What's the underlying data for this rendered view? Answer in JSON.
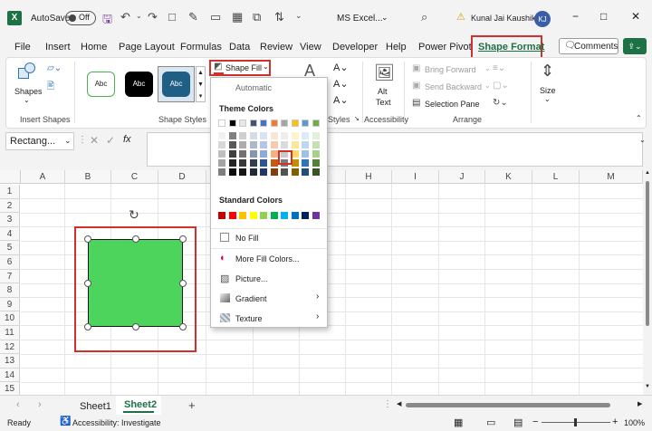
{
  "titlebar": {
    "autosave_label": "AutoSave",
    "autosave_state": "Off",
    "file_name": "MS Excel...",
    "user_name": "Kunal Jai Kaushik",
    "user_initials": "KJ"
  },
  "menu": {
    "tabs": [
      "File",
      "Insert",
      "Home",
      "Page Layout",
      "Formulas",
      "Data",
      "Review",
      "View",
      "Developer",
      "Help",
      "Power Pivot",
      "Shape Format"
    ],
    "active_tab": "Shape Format",
    "comments_label": "Comments"
  },
  "ribbon": {
    "insert_shapes": {
      "shapes_label": "Shapes",
      "group_label": "Insert Shapes"
    },
    "shape_styles": {
      "samples": [
        "Abc",
        "Abc",
        "Abc"
      ],
      "group_label": "Shape Styles",
      "shape_fill_label": "Shape Fill"
    },
    "partial_labels": [
      "Styles",
      "Accessibility"
    ],
    "alt_text": {
      "line1": "Alt",
      "line2": "Text"
    },
    "arrange": {
      "bring_forward": "Bring Forward",
      "send_backward": "Send Backward",
      "selection_pane": "Selection Pane",
      "group_label": "Arrange"
    },
    "size_label": "Size"
  },
  "formula_bar": {
    "name_box": "Rectang...",
    "fx": "fx"
  },
  "grid": {
    "columns": [
      "A",
      "B",
      "C",
      "D",
      "E",
      "F",
      "G",
      "H",
      "I",
      "J",
      "K",
      "L",
      "M"
    ],
    "rows": [
      "1",
      "2",
      "3",
      "4",
      "5",
      "6",
      "7",
      "8",
      "9",
      "10",
      "11",
      "12",
      "13",
      "14",
      "15"
    ]
  },
  "shape": {
    "fill_color": "#4cd45c",
    "outline_color": "#1a1a1a"
  },
  "dropdown": {
    "automatic": "Automatic",
    "theme_colors_label": "Theme Colors",
    "theme_top_row": [
      "#ffffff",
      "#000000",
      "#e7e6e6",
      "#44546a",
      "#4472c4",
      "#ed7d31",
      "#a5a5a5",
      "#ffc000",
      "#5b9bd5",
      "#70ad47"
    ],
    "theme_shades": [
      [
        "#f2f2f2",
        "#7f7f7f",
        "#d0cece",
        "#d6dce4",
        "#d9e2f3",
        "#fbe5d5",
        "#ededed",
        "#fff2cc",
        "#deebf6",
        "#e2efd9"
      ],
      [
        "#d8d8d8",
        "#595959",
        "#aeabab",
        "#adb9ca",
        "#b4c6e7",
        "#f7cbac",
        "#dbdbdb",
        "#fee599",
        "#bdd7ee",
        "#c5e0b3"
      ],
      [
        "#bfbfbf",
        "#3f3f3f",
        "#757070",
        "#8496b0",
        "#8eaadb",
        "#f4b183",
        "#c9c9c9",
        "#ffd965",
        "#9cc3e5",
        "#a8d08d"
      ],
      [
        "#a5a5a5",
        "#262626",
        "#3a3838",
        "#323f4f",
        "#2f5496",
        "#c55a11",
        "#7b7b7b",
        "#bf9000",
        "#2e75b5",
        "#538135"
      ],
      [
        "#7f7f7f",
        "#0c0c0c",
        "#171616",
        "#222a35",
        "#1f3864",
        "#833c0b",
        "#525252",
        "#7f6000",
        "#1e4e79",
        "#375623"
      ]
    ],
    "standard_colors_label": "Standard Colors",
    "standard_colors": [
      "#c00000",
      "#ff0000",
      "#ffc000",
      "#ffff00",
      "#92d050",
      "#00b050",
      "#00b0f0",
      "#0070c0",
      "#002060",
      "#7030a0"
    ],
    "no_fill": "No Fill",
    "more_fill": "More Fill Colors...",
    "picture": "Picture...",
    "gradient": "Gradient",
    "texture": "Texture"
  },
  "sheets": {
    "tabs": [
      "Sheet1",
      "Sheet2"
    ],
    "active": "Sheet2"
  },
  "status": {
    "ready": "Ready",
    "accessibility": "Accessibility: Investigate",
    "zoom": "100%"
  },
  "colors": {
    "highlight_red": "#d0312d",
    "ribbon_green": "#1e7145",
    "avatar_blue": "#3a5ea8"
  }
}
